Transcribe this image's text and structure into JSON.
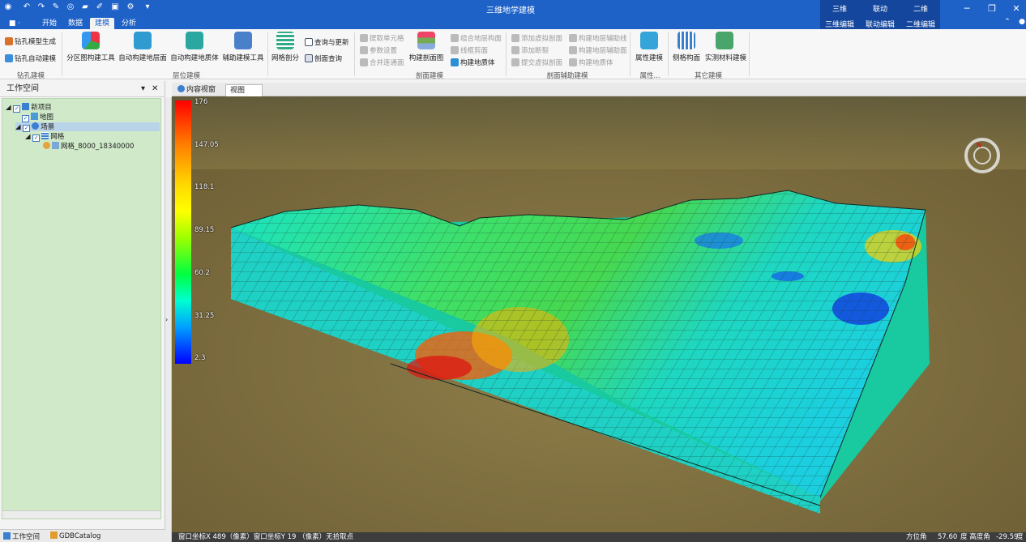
{
  "app": {
    "title": "三维地学建模"
  },
  "menu": {
    "file_label": "■ ·",
    "tabs": [
      "开始",
      "数据",
      "建模",
      "分析"
    ]
  },
  "context_tabs": {
    "row1": [
      "三维",
      "联动",
      "二维"
    ],
    "row2": [
      "三维编辑",
      "联动编辑",
      "二维编辑"
    ]
  },
  "ribbon": {
    "borehole": {
      "items": [
        "钻孔模型生成",
        "钻孔自动建模"
      ],
      "group": "钻孔建模"
    },
    "layer": {
      "buttons": [
        "分区图构建工具",
        "自动构建地层面",
        "自动构建地质体",
        "辅助建模工具"
      ],
      "group": "层位建模"
    },
    "grid": {
      "button": "网格剖分",
      "items": [
        "查询与更新",
        "剖面查询"
      ]
    },
    "section": {
      "small_left": [
        "提取单元格",
        "参数设置",
        "合并连通面"
      ],
      "button": "构建剖面图",
      "small_right": [
        "组合地层构面",
        "线框剪面",
        "构建地质体"
      ],
      "group": "剖面建模"
    },
    "aux": {
      "col1": [
        "添加虚拟剖面",
        "添加断裂",
        "提交虚拟剖面"
      ],
      "col2": [
        "构建地层辅助线",
        "构建地层辅助面",
        "构建地质体"
      ],
      "group": "剖面辅助建模"
    },
    "attr": {
      "button": "属性建模",
      "group": "属性..."
    },
    "other": {
      "buttons": [
        "侧格构面",
        "实测材料建模"
      ],
      "group": "其它建模"
    }
  },
  "workspace": {
    "title": "工作空间",
    "pin": "▾",
    "close": "✕",
    "tree": [
      {
        "label": "新项目"
      },
      {
        "label": "地图"
      },
      {
        "label": "场景"
      },
      {
        "label": "网格"
      },
      {
        "label": "网格_8000_18340000"
      }
    ],
    "bottom_tabs": [
      "工作空间",
      "GDBCatalog"
    ]
  },
  "doc_tabs": [
    "内容视窗",
    "视图"
  ],
  "doc_close": "✕",
  "legend": {
    "values": [
      "176",
      "147.05",
      "118.1",
      "89.15",
      "60.2",
      "31.25",
      "2.3"
    ],
    "min": 2.3,
    "max": 176
  },
  "status": {
    "text": "窗口坐标X 489（像素）窗口坐标Y 19 （像素）无拾取点",
    "azimuth_label": "方位角",
    "azimuth": "57.60",
    "elev_label": "度 高度角",
    "elev": "-29.59",
    "unit": "度"
  },
  "colors": {
    "title_bg": "#1e62c8",
    "tree_bg": "#cfe9c9",
    "status_bg": "#3d3d3d",
    "terrain": "#8b7a47"
  }
}
